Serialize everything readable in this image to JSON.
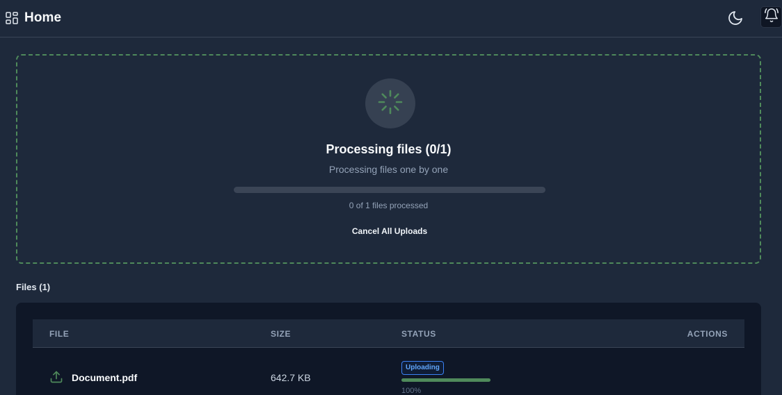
{
  "header": {
    "title": "Home",
    "menu_icon": "grid-icon",
    "theme_icon": "moon-icon",
    "notification_icon": "bell-icon"
  },
  "upload": {
    "spinner_icon": "spinner-icon",
    "title": "Processing files (0/1)",
    "subtitle": "Processing files one by one",
    "progress_fraction": 0,
    "count_text": "0 of 1 files processed",
    "cancel_label": "Cancel All Uploads"
  },
  "files": {
    "label": "Files (1)",
    "columns": [
      "FILE",
      "SIZE",
      "STATUS",
      "ACTIONS"
    ],
    "rows": [
      {
        "icon": "upload-icon",
        "name": "Document.pdf",
        "size": "642.7 KB",
        "status": "Uploading",
        "progress_fraction": 1.0,
        "percent_text": "100%"
      }
    ]
  },
  "colors": {
    "background": "#1e293b",
    "accent_green": "#4f8a5b",
    "status_blue": "#60a5fa"
  }
}
